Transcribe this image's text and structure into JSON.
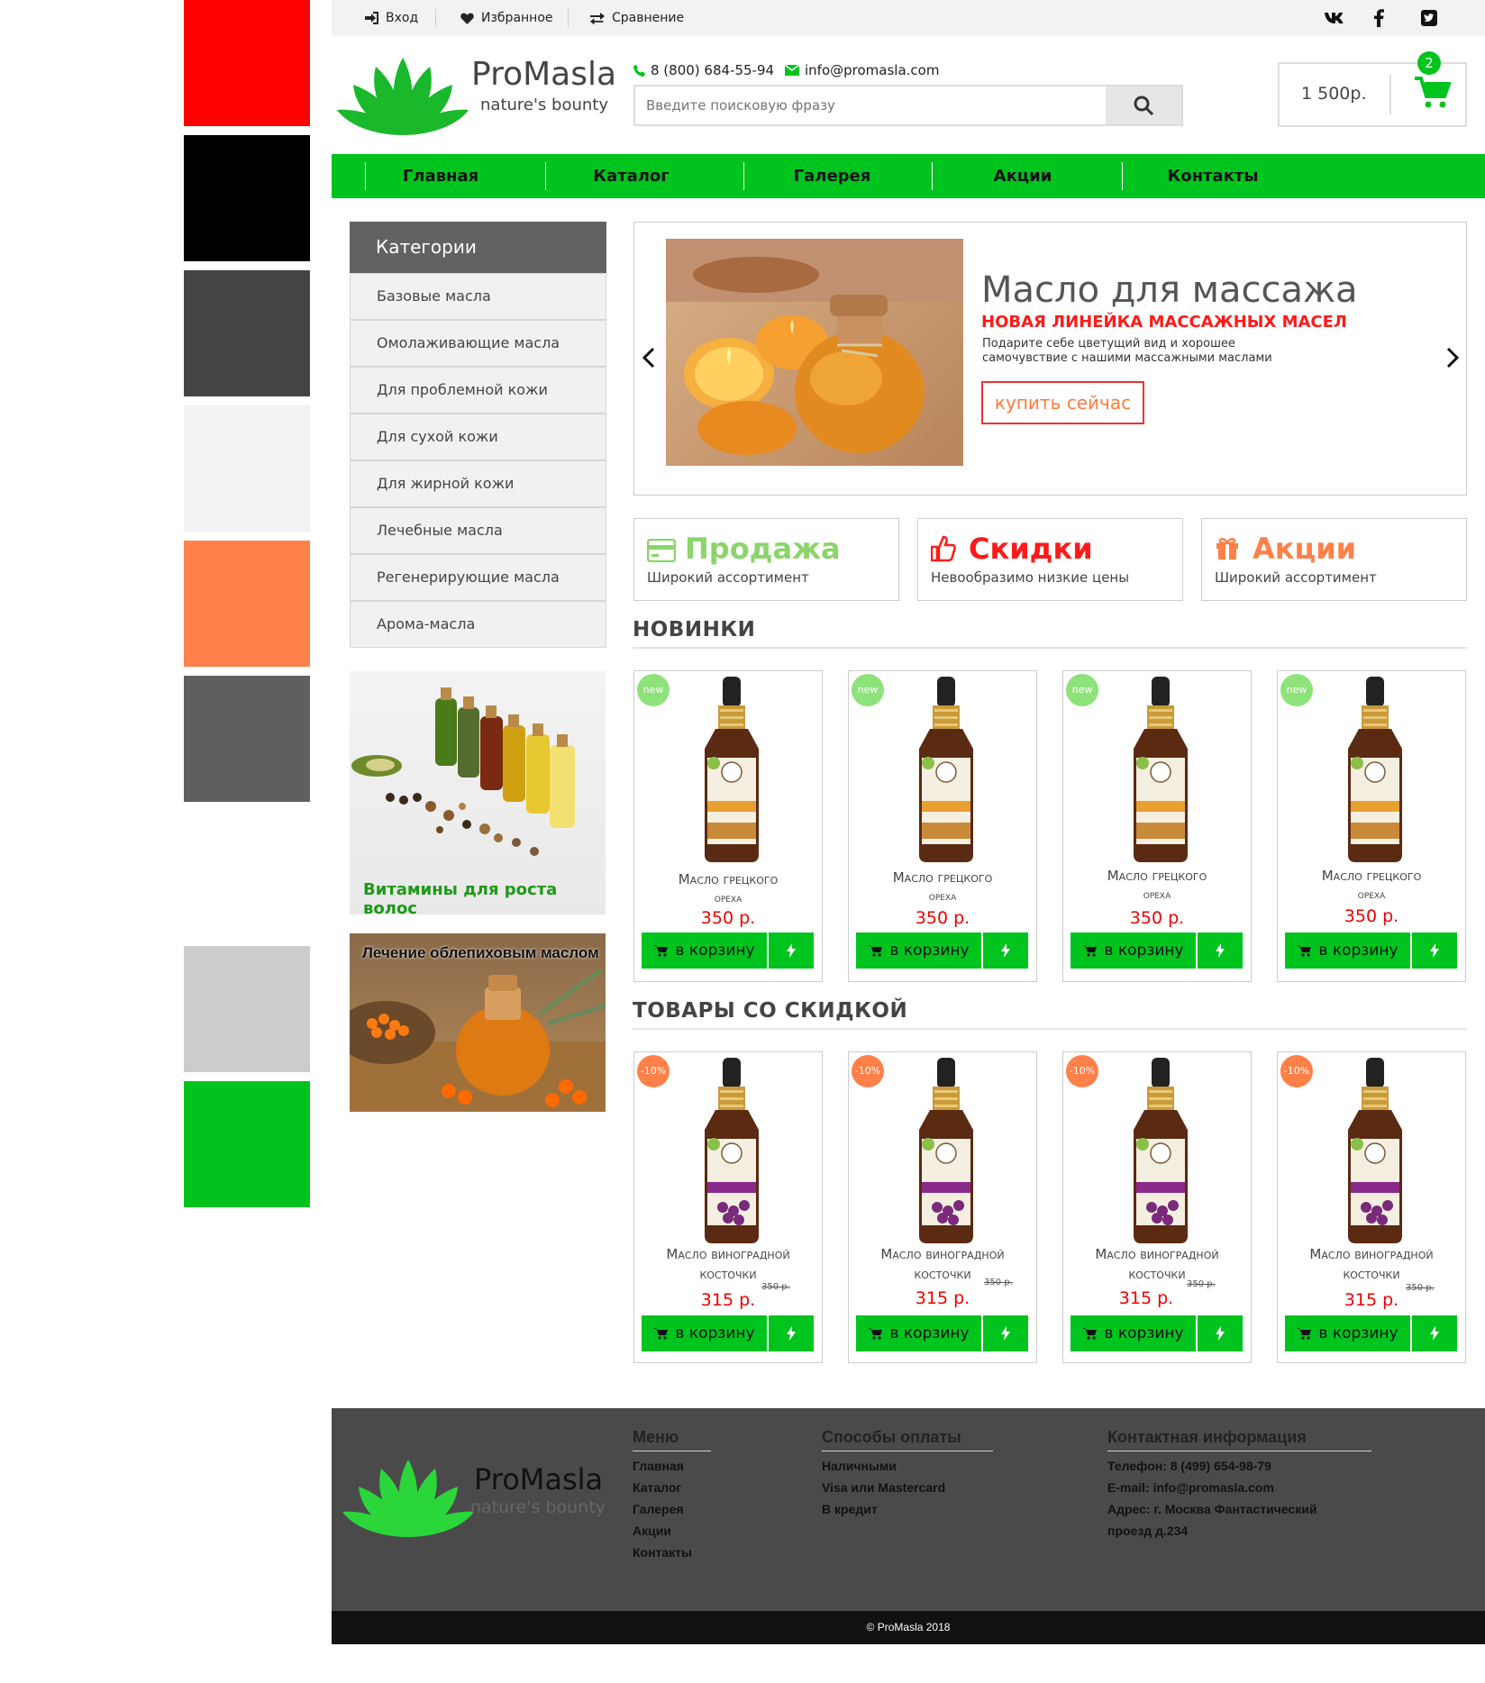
{
  "palette": {
    "red": "#ff0000",
    "black": "#000000",
    "dark_gray": "#444444",
    "light_gray": "#f2f2f2",
    "orange": "#ff8048",
    "mid_gray": "#5f5f5f",
    "silver": "#cccccc",
    "green": "#00c41e"
  },
  "topbar": {
    "login": "Вход",
    "favorites": "Избранное",
    "compare": "Сравнение",
    "social_icons": [
      "vk-icon",
      "facebook-icon",
      "twitter-icon"
    ]
  },
  "header": {
    "brand": "ProMasla",
    "tagline": "nature's bounty",
    "phone": "8 (800) 684-55-94",
    "email": "info@promasla.com",
    "search_placeholder": "Введите поисковую фразу",
    "cart_total": "1 500р.",
    "cart_count": "2"
  },
  "nav": [
    "Главная",
    "Каталог",
    "Галерея",
    "Акции",
    "Контакты"
  ],
  "sidebar": {
    "title": "Категории",
    "items": [
      "Базовые масла",
      "Омолаживающие масла",
      "Для проблемной кожи",
      "Для сухой кожи",
      "Для жирной кожи",
      "Лечебные масла",
      "Регенерирующие масла",
      "Арома-масла"
    ],
    "banner1": "Витамины для роста волос",
    "banner2": "Лечение облепиховым маслом"
  },
  "slider": {
    "title": "Масло для массажа",
    "subtitle": "НОВАЯ ЛИНЕЙКА МАССАЖНЫХ МАСЕЛ",
    "text_line1": "Подарите себе цветущий вид и хорошее",
    "text_line2": "самочувствие с нашими массажными маслами",
    "button": "купить сейчас"
  },
  "features": [
    {
      "title": "Продажа",
      "sub": "Широкий ассортимент",
      "color": "#8bd56b",
      "icon": "card-icon"
    },
    {
      "title": "Скидки",
      "sub": "Невообразимо низкие цены",
      "color": "#ff1a1a",
      "icon": "thumbs-up-icon"
    },
    {
      "title": "Акции",
      "sub": "Широкий ассортимент",
      "color": "#ff8048",
      "icon": "gift-icon"
    }
  ],
  "new_section": {
    "title": "НОВИНКИ",
    "badge": "new",
    "products": [
      {
        "name_line1": "Масло грецкого",
        "name_line2": "ореха",
        "price": "350 р.",
        "cart": "в корзину"
      },
      {
        "name_line1": "Масло грецкого",
        "name_line2": "ореха",
        "price": "350 р.",
        "cart": "в корзину"
      },
      {
        "name_line1": "Масло грецкого",
        "name_line2": "ореха",
        "price": "350 р.",
        "cart": "в корзину"
      },
      {
        "name_line1": "Масло грецкого",
        "name_line2": "ореха",
        "price": "350 р.",
        "cart": "в корзину"
      }
    ]
  },
  "sale_section": {
    "title": "ТОВАРЫ СО СКИДКОЙ",
    "badge": "-10%",
    "products": [
      {
        "name_line1": "Масло виноградной",
        "name_line2": "косточки",
        "old_price": "350 р.",
        "price": "315 р.",
        "cart": "в корзину"
      },
      {
        "name_line1": "Масло виноградной",
        "name_line2": "косточки",
        "old_price": "350 р.",
        "price": "315 р.",
        "cart": "в корзину"
      },
      {
        "name_line1": "Масло виноградной",
        "name_line2": "косточки",
        "old_price": "350 р.",
        "price": "315 р.",
        "cart": "в корзину"
      },
      {
        "name_line1": "Масло виноградной",
        "name_line2": "косточки",
        "old_price": "350 р.",
        "price": "315 р.",
        "cart": "в корзину"
      }
    ]
  },
  "footer": {
    "brand": "ProMasla",
    "tagline": "nature's bounty",
    "menu_title": "Меню",
    "menu": [
      "Главная",
      "Каталог",
      "Галерея",
      "Акции",
      "Контакты"
    ],
    "payment_title": "Способы оплаты",
    "payment": [
      "Наличными",
      "Visa или Mastercard",
      "В кредит"
    ],
    "contact_title": "Контактная информация",
    "contact": [
      "Телефон: 8 (499) 654-98-79",
      "E-mail: info@promasla.com",
      "Адрес: г. Москва Фантастический",
      "проезд д.234"
    ],
    "copyright": "© ProMasla 2018"
  }
}
